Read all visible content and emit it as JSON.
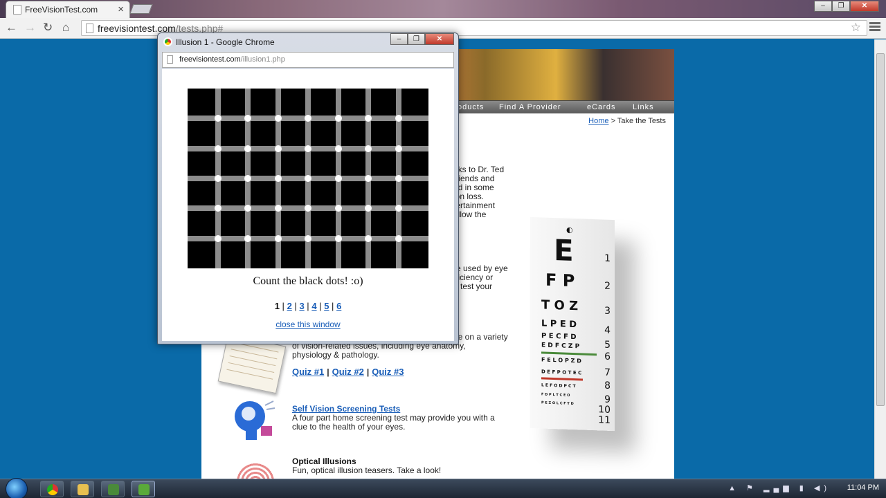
{
  "browser": {
    "tab_title": "FreeVisionTest.com",
    "url_host": "freevisiontest.com",
    "url_path": "/tests.php#"
  },
  "site": {
    "nav": [
      "oducts",
      "Find A Provider",
      "eCards",
      "Links"
    ],
    "breadcrumb": {
      "home": "Home",
      "sep": ">",
      "current": "Take the Tests"
    },
    "intro_lines": [
      "nks to Dr. Ted",
      "friends and",
      "nd in some",
      "ion loss.",
      "tertainment",
      "ollow the"
    ],
    "tests_lines": [
      "re used by eye",
      "fficiency or",
      "o test your"
    ],
    "quiz_lines": [
      "ge on a variety",
      "of vision-related issues, including eye anatomy,",
      "physiology & pathology."
    ],
    "quizzes": [
      "Quiz #1",
      "Quiz #2",
      "Quiz #3"
    ],
    "quiz_sep": "|",
    "screening_title": "Self Vision Screening Tests",
    "screening_text": [
      "A four part home screening test may provide you with a",
      "clue to the health of your eyes."
    ],
    "illusions_title": "Optical Illusions",
    "illusions_text": "Fun, optical illusion teasers. Take a look!",
    "eyechart": {
      "rows": [
        "E",
        "F P",
        "T O Z",
        "L P E D",
        "P E C F D",
        "E D F C Z P",
        "F E L O P Z D",
        "D E F P O T E C",
        "L E F O D P C T",
        "F D P L T C E O",
        "P E Z O L C F T D"
      ],
      "numbers": [
        "1",
        "2",
        "3",
        "4",
        "5",
        "6",
        "7",
        "8",
        "9",
        "10",
        "11"
      ]
    }
  },
  "popup": {
    "title": "Illusion 1 - Google Chrome",
    "url_host": "freevisiontest.com",
    "url_path": "/illusion1.php",
    "caption": "Count the black dots! :o)",
    "pages": [
      "1",
      "2",
      "3",
      "4",
      "5",
      "6"
    ],
    "page_sep": "|",
    "current_page": "1",
    "close_link": "close this window"
  },
  "taskbar": {
    "clock": "11:04 PM"
  },
  "colors": {
    "desktop": "#0a6aa8",
    "link": "#1a5eb8",
    "grid_line": "#8c8c8c"
  }
}
